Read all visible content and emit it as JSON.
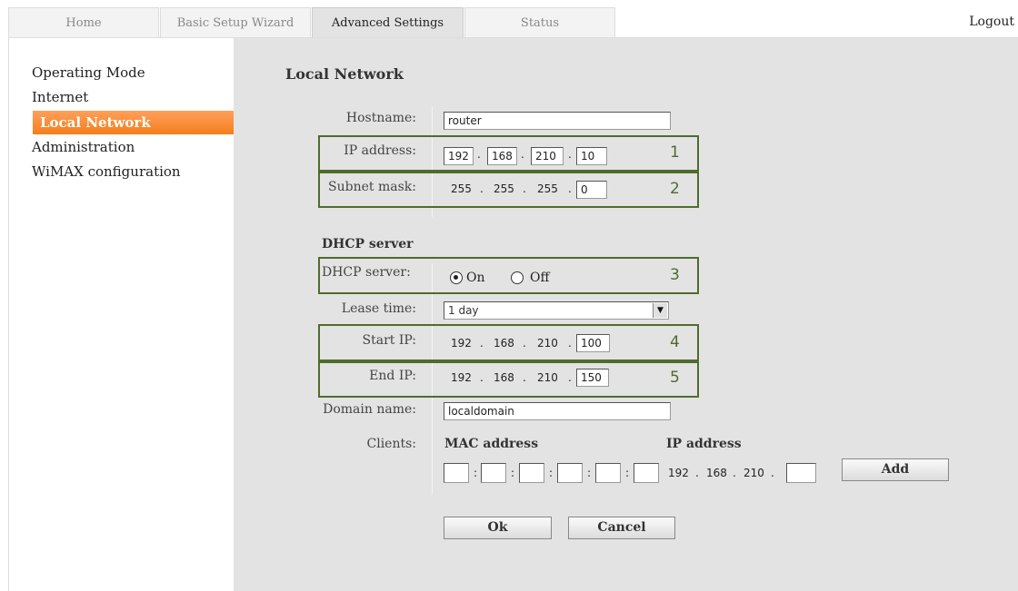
{
  "tabs": {
    "home": "Home",
    "wizard": "Basic Setup Wizard",
    "advanced": "Advanced Settings",
    "status": "Status"
  },
  "logout": "Logout",
  "sidebar": {
    "items": [
      "Operating Mode",
      "Internet",
      "Local Network",
      "Administration",
      "WiMAX configuration"
    ],
    "active_index": 2
  },
  "page": {
    "title": "Local Network",
    "hostname": {
      "label": "Hostname:",
      "value": "router"
    },
    "ip_address": {
      "label": "IP address:",
      "octets": [
        "192",
        "168",
        "210",
        "10"
      ],
      "marker": "1"
    },
    "subnet_mask": {
      "label": "Subnet mask:",
      "octets": [
        "255",
        "255",
        "255",
        "0"
      ],
      "marker": "2"
    },
    "dhcp": {
      "section_title": "DHCP server",
      "server_label": "DHCP server:",
      "on_label": "On",
      "off_label": "Off",
      "selected": "On",
      "marker": "3",
      "lease_label": "Lease time:",
      "lease_value": "1 day",
      "start_label": "Start IP:",
      "start_octets": [
        "192",
        "168",
        "210",
        "100"
      ],
      "start_marker": "4",
      "end_label": "End IP:",
      "end_octets": [
        "192",
        "168",
        "210",
        "150"
      ],
      "end_marker": "5",
      "domain_label": "Domain name:",
      "domain_value": "localdomain",
      "clients_label": "Clients:",
      "mac_header": "MAC address",
      "ip_header": "IP address",
      "client_ip_prefix": [
        "192",
        "168",
        "210"
      ],
      "add_button": "Add"
    },
    "ok_button": "Ok",
    "cancel_button": "Cancel"
  },
  "colors": {
    "accent": "#f47e1c",
    "marker_green": "#4f6b2d",
    "panel": "#e3e3e3"
  }
}
